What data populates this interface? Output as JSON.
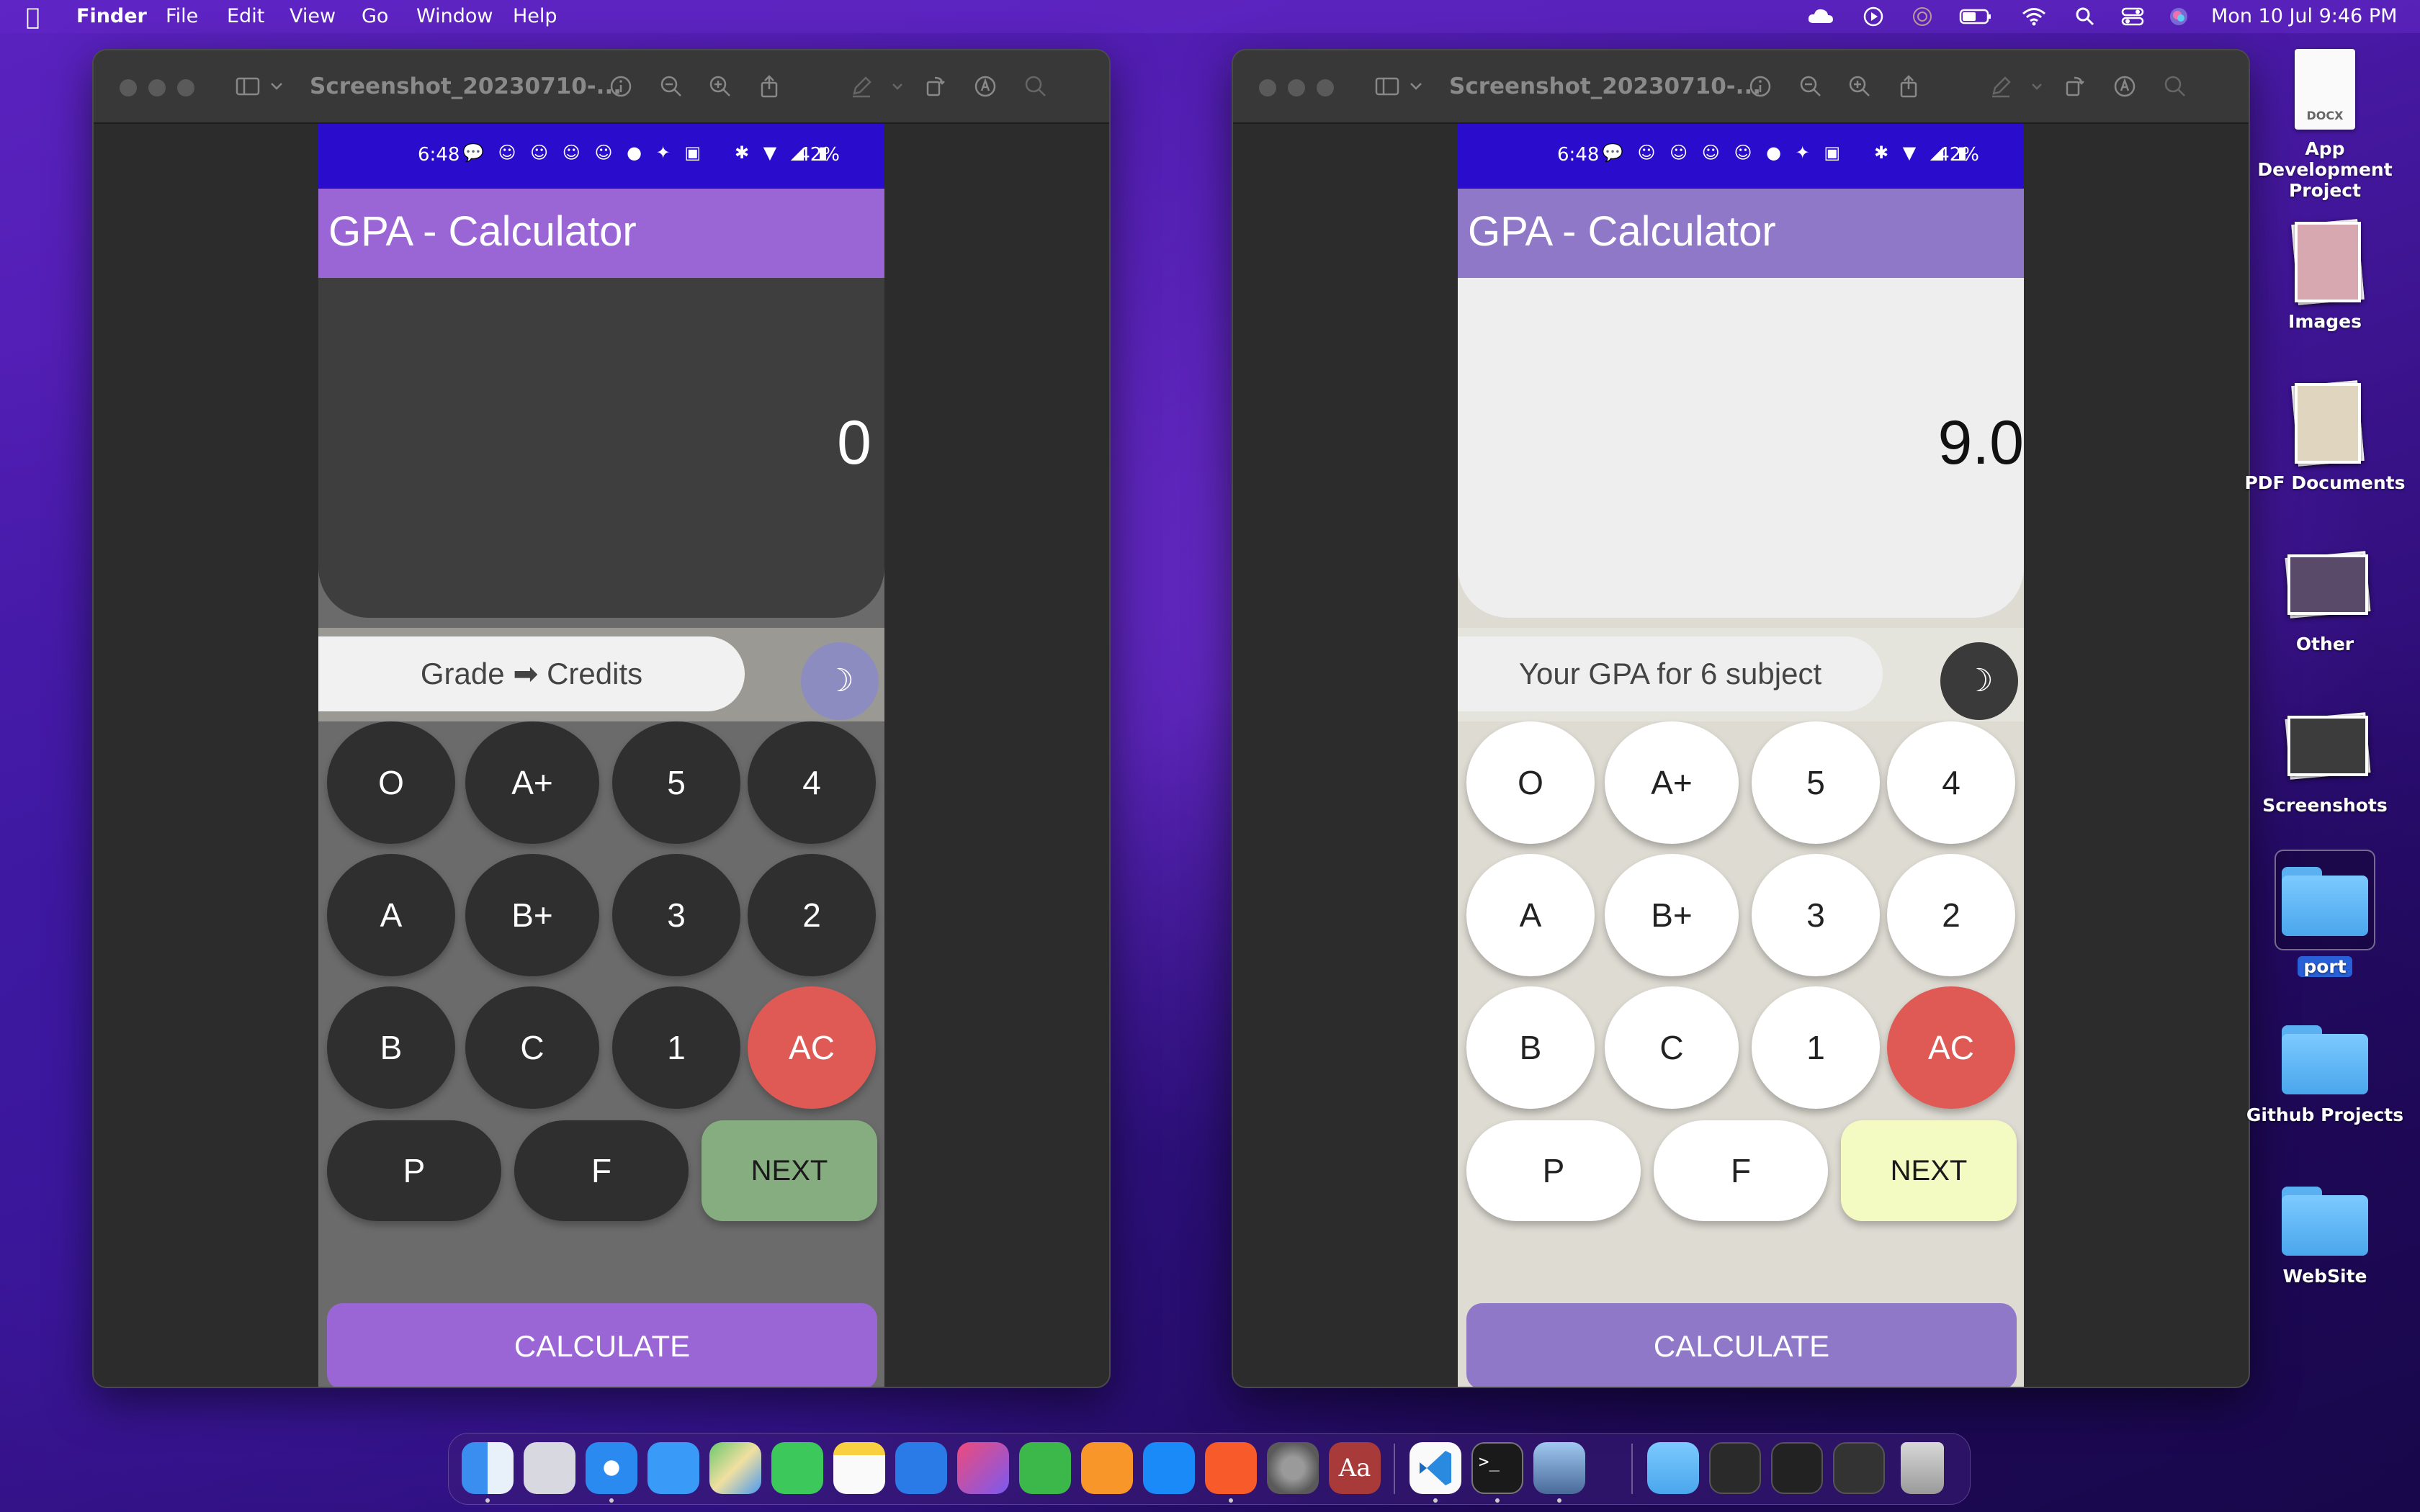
{
  "menubar": {
    "app": "Finder",
    "menus": [
      "File",
      "Edit",
      "View",
      "Go",
      "Window",
      "Help"
    ],
    "clock": "Mon 10 Jul  9:46 PM"
  },
  "windows": [
    {
      "title": "Screenshot_20230710-...",
      "theme": "dark",
      "phone": {
        "time": "6:48",
        "battery": "42%",
        "app_title": "GPA - Calculator",
        "display_value": "0",
        "info_text": "Grade ➡ Credits",
        "moon_glyph": "☽",
        "keys": [
          [
            "O",
            "A+",
            "5",
            "4"
          ],
          [
            "A",
            "B+",
            "3",
            "2"
          ],
          [
            "B",
            "C",
            "1",
            "AC"
          ]
        ],
        "bottom_keys": [
          "P",
          "F",
          "NEXT"
        ],
        "calculate_label": "CALCULATE"
      }
    },
    {
      "title": "Screenshot_20230710-...",
      "theme": "light",
      "phone": {
        "time": "6:48",
        "battery": "42%",
        "app_title": "GPA - Calculator",
        "display_value": "9.0",
        "info_text": "Your GPA for 6 subject",
        "moon_glyph": "☽",
        "keys": [
          [
            "O",
            "A+",
            "5",
            "4"
          ],
          [
            "A",
            "B+",
            "3",
            "2"
          ],
          [
            "B",
            "C",
            "1",
            "AC"
          ]
        ],
        "bottom_keys": [
          "P",
          "F",
          "NEXT"
        ],
        "calculate_label": "CALCULATE"
      }
    }
  ],
  "desktop": [
    {
      "label": "App Development Project",
      "type": "docx",
      "badge": "DOCX"
    },
    {
      "label": "Images",
      "type": "stack"
    },
    {
      "label": "PDF Documents",
      "type": "stack"
    },
    {
      "label": "Other",
      "type": "stack"
    },
    {
      "label": "Screenshots",
      "type": "stack"
    },
    {
      "label": "port",
      "type": "folder"
    },
    {
      "label": "Github Projects",
      "type": "folder"
    },
    {
      "label": "WebSite",
      "type": "folder"
    }
  ],
  "dock": {
    "apps": [
      "Finder",
      "Launchpad",
      "Safari",
      "Mail",
      "Maps",
      "FaceTime",
      "Notes",
      "Keynote",
      "Creative",
      "Numbers",
      "Pages",
      "App Store",
      "Brave",
      "System Settings",
      "Dictionary",
      "VS Code",
      "Terminal",
      "Preview"
    ],
    "trash_label": "Trash"
  },
  "colors": {
    "dark_display": "#3f3e3f",
    "dark_keypad": "#6b6b6b",
    "dark_key": "#2f2f2f",
    "ac_key": "#e05a55",
    "dark_next": "#86ad80",
    "calc_dark": "#9a66d6",
    "light_display": "#eeeeee",
    "light_keypad": "#dddbd2",
    "light_next": "#f3fbc2",
    "calc_light": "#8f78c8"
  }
}
